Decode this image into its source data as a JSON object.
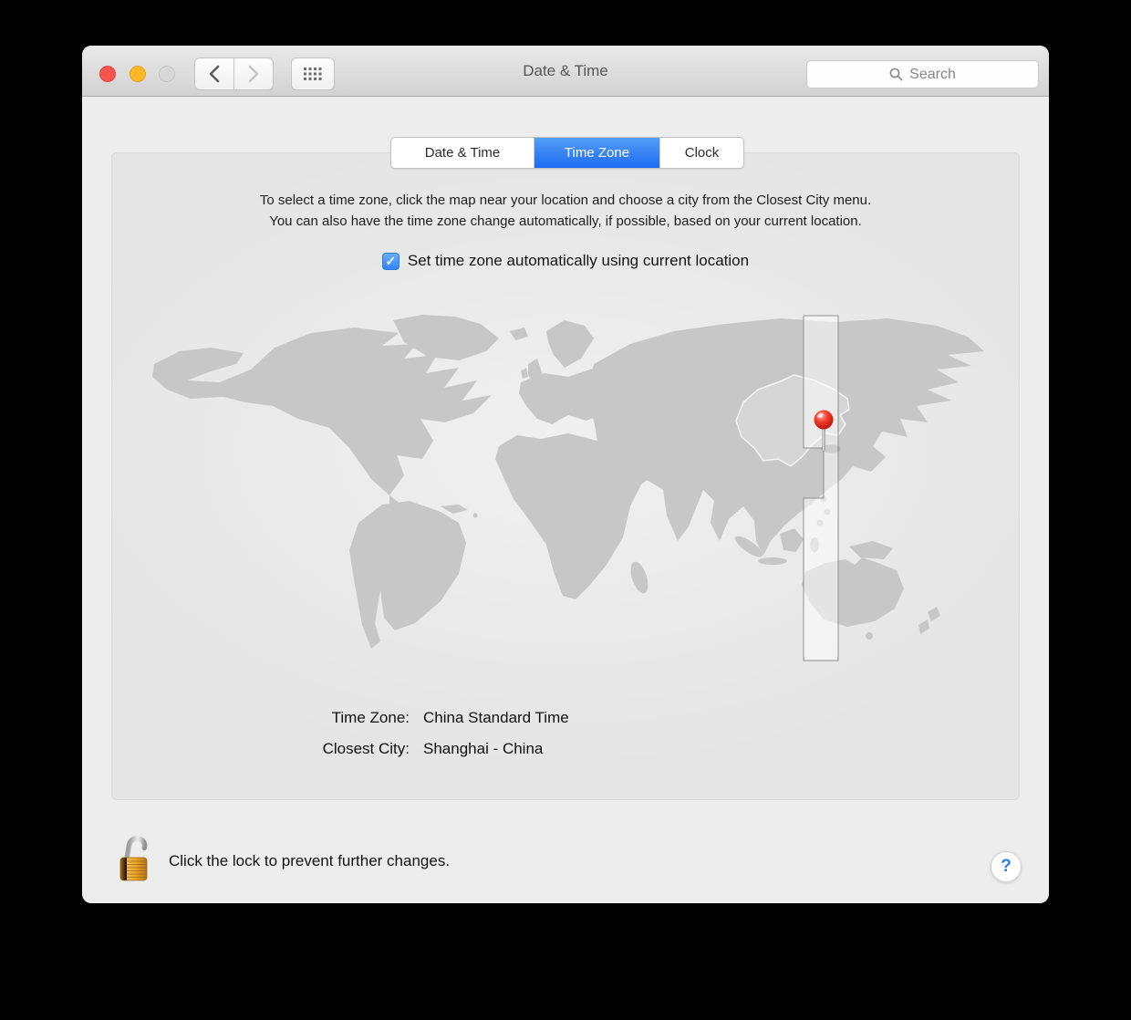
{
  "window": {
    "title": "Date & Time"
  },
  "toolbar": {
    "search_placeholder": "Search"
  },
  "tabs": [
    {
      "label": "Date & Time",
      "selected": false
    },
    {
      "label": "Time Zone",
      "selected": true
    },
    {
      "label": "Clock",
      "selected": false
    }
  ],
  "content": {
    "instructions_line1": "To select a time zone, click the map near your location and choose a city from the Closest City menu.",
    "instructions_line2": "You can also have the time zone change automatically, if possible, based on your current location.",
    "auto_checkbox": {
      "checked": true,
      "checkmark_glyph": "✓",
      "label": "Set time zone automatically using current location"
    },
    "time_zone": {
      "label": "Time Zone:",
      "value": "China Standard Time"
    },
    "closest_city": {
      "label": "Closest City:",
      "value": "Shanghai - China"
    }
  },
  "map": {
    "pin_icon": "red-map-pin",
    "pin_color": "#e0281b",
    "highlight_band": "selected-time-zone-band"
  },
  "footer": {
    "lock_icon": "unlocked-padlock",
    "lock_text": "Click the lock to prevent further changes.",
    "help_label": "?"
  },
  "colors": {
    "selected_tab_top": "#549ef8",
    "selected_tab_bottom": "#1d6bf1",
    "checkbox_blue": "#2f85f6",
    "land_gray": "#c7c7c7"
  }
}
